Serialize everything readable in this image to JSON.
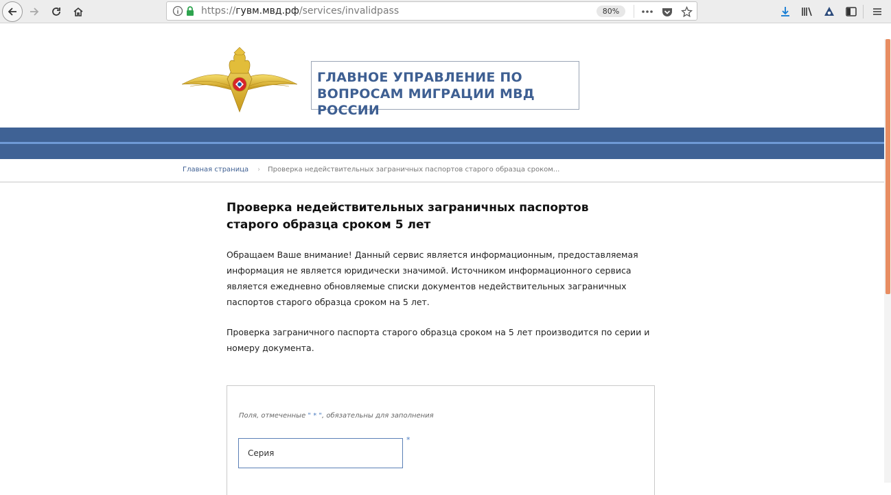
{
  "browser": {
    "url_prefix": "https://",
    "url_domain": "гувм.мвд.рф",
    "url_path": "/services/invalidpass",
    "zoom": "80%"
  },
  "site": {
    "title_line1": "ГЛАВНОЕ УПРАВЛЕНИЕ ПО",
    "title_line2": "ВОПРОСАМ МИГРАЦИИ МВД РОССИИ"
  },
  "breadcrumb": {
    "home": "Главная страница",
    "current": "Проверка недействительных заграничных паспортов старого образца сроком..."
  },
  "main": {
    "title": "Проверка недействительных заграничных паспортов старого образца сроком 5 лет",
    "paragraph1": "Обращаем Ваше внимание! Данный сервис является информационным, предоставляемая информация не является юридически значимой. Источником информационного сервиса является ежедневно обновляемые списки документов недействительных заграничных паспортов старого образца сроком на 5 лет.",
    "paragraph2": "Проверка заграничного паспорта старого образца сроком на 5 лет производится по серии и номеру документа."
  },
  "form": {
    "note_prefix": "Поля, отмеченные",
    "note_star": "\" * \"",
    "note_suffix": ", обязательны для заполнения",
    "series_placeholder": "Серия",
    "required_mark": "*"
  },
  "colors": {
    "brand_blue": "#3f6295",
    "brand_light_blue": "#6f9ad6",
    "scroll_accent": "#e88d62"
  }
}
